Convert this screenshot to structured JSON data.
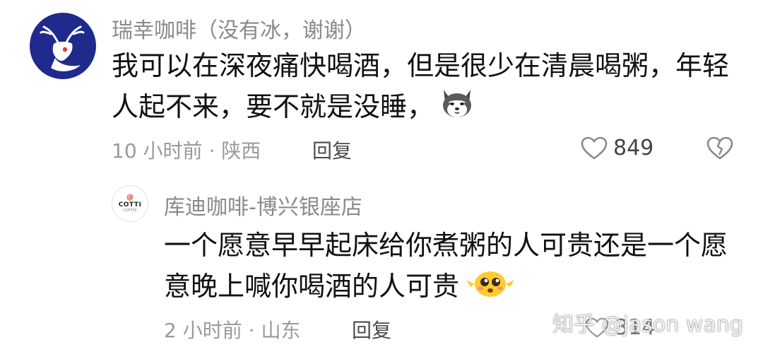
{
  "comment": {
    "username": "瑞幸咖啡（没有冰，谢谢）",
    "text": "我可以在深夜痛快喝酒，但是很少在清晨喝粥，年轻人起不来，要不就是没睡，",
    "time": "10 小时前",
    "separator": "·",
    "location": "陕西",
    "reply_label": "回复",
    "likes": "849",
    "avatar_icon": "white-deer-logo-icon",
    "emoji_icon": "husky-dog-emoji-icon",
    "avatar_color": "#1f2a8c"
  },
  "reply": {
    "username": "库迪咖啡-博兴银座店",
    "text": "一个愿意早早起床给你煮粥的人可贵还是一个愿意晚上喊你喝酒的人可贵",
    "time": "2 小时前",
    "separator": "·",
    "location": "山东",
    "reply_label": "回复",
    "likes": "314",
    "avatar": {
      "mark": "@",
      "brand": "COTTI",
      "sub": "COFFEE"
    },
    "emoji_icon": "pleading-face-emoji-icon"
  },
  "watermark": "知乎 @jason wang"
}
